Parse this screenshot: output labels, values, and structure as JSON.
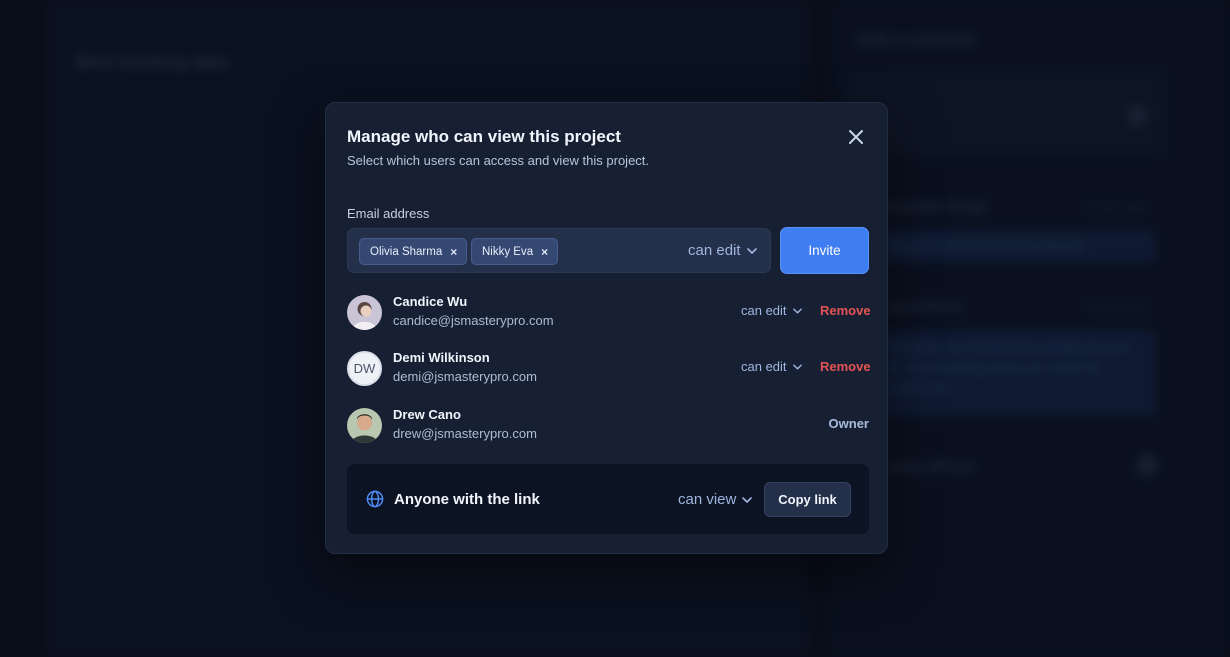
{
  "background": {
    "left_title": "Bird tracking data",
    "right_title": "Add a comment",
    "entries": [
      {
        "title": "Brooklyn Singh",
        "meta": "3 hours ago",
        "text": "Can you check the final dashboard"
      },
      {
        "title": "Jacob Ross",
        "meta": "4 hours ago",
        "text": "Hey team, I've finished the dashboard and the new reporting charts are ready for review now"
      },
      {
        "title": "Jenny Wilson",
        "meta": ""
      }
    ]
  },
  "modal": {
    "title": "Manage who can view this project",
    "subtitle": "Select which users can access and view this project.",
    "email_label": "Email address",
    "chips": [
      "Olivia Sharma",
      "Nikky Eva"
    ],
    "chip_remove_glyph": "×",
    "invite_permission": "can edit",
    "invite_button": "Invite",
    "users": [
      {
        "name": "Candice Wu",
        "email": "candice@jsmasterypro.com",
        "permission": "can edit",
        "action": "Remove"
      },
      {
        "name": "Demi Wilkinson",
        "initials": "DW",
        "email": "demi@jsmasterypro.com",
        "permission": "can edit",
        "action": "Remove"
      },
      {
        "name": "Drew Cano",
        "email": "drew@jsmasterypro.com",
        "role": "Owner"
      }
    ],
    "link_sharing": {
      "label": "Anyone with the link",
      "permission": "can view",
      "copy_button": "Copy link"
    }
  },
  "colors": {
    "accent": "#3f7df2",
    "danger": "#e25454",
    "modal_bg": "#172033",
    "page_bg": "#0b1120"
  },
  "icons": {
    "close": "close-icon",
    "chevron": "chevron-down-icon",
    "globe": "globe-icon"
  }
}
